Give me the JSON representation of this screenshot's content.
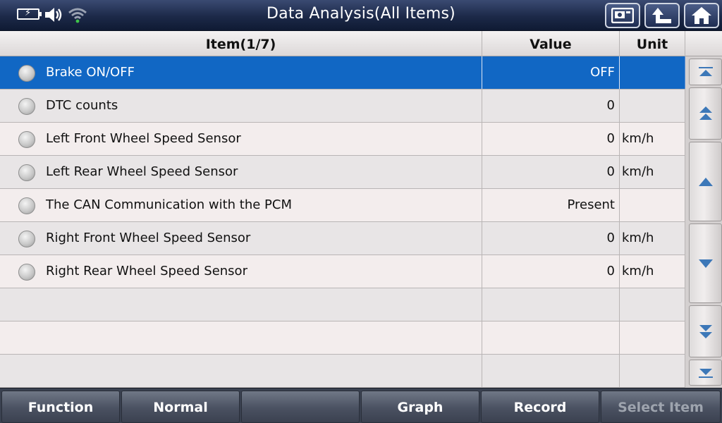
{
  "window": {
    "title": "Data Analysis(All Items)"
  },
  "status_icons": [
    "battery-charging-icon",
    "speaker-icon",
    "wifi-icon"
  ],
  "toolbar_icons": [
    "screenshot-icon",
    "back-icon",
    "home-icon"
  ],
  "table": {
    "headers": {
      "item": "Item(1/7)",
      "value": "Value",
      "unit": "Unit"
    },
    "rows": [
      {
        "item": "Brake ON/OFF",
        "value": "OFF",
        "unit": "",
        "selected": true
      },
      {
        "item": "DTC counts",
        "value": "0",
        "unit": ""
      },
      {
        "item": "Left Front Wheel Speed Sensor",
        "value": "0",
        "unit": "km/h"
      },
      {
        "item": "Left Rear Wheel Speed Sensor",
        "value": "0",
        "unit": "km/h"
      },
      {
        "item": "The CAN Communication with the PCM",
        "value": "Present",
        "unit": ""
      },
      {
        "item": "Right Front Wheel Speed Sensor",
        "value": "0",
        "unit": "km/h"
      },
      {
        "item": "Right Rear Wheel Speed Sensor",
        "value": "0",
        "unit": "km/h"
      }
    ]
  },
  "scroller_icons": [
    "scroll-top-icon",
    "page-up-icon",
    "scroll-up-icon",
    "scroll-down-icon",
    "page-down-icon",
    "scroll-bottom-icon"
  ],
  "footer": {
    "function": "Function",
    "normal": "Normal",
    "graph": "Graph",
    "record": "Record",
    "select_item": "Select Item"
  },
  "colors": {
    "selected_row": "#1167c4",
    "title_bar": "#1c2948",
    "disabled_text": "#9ea4ae"
  }
}
